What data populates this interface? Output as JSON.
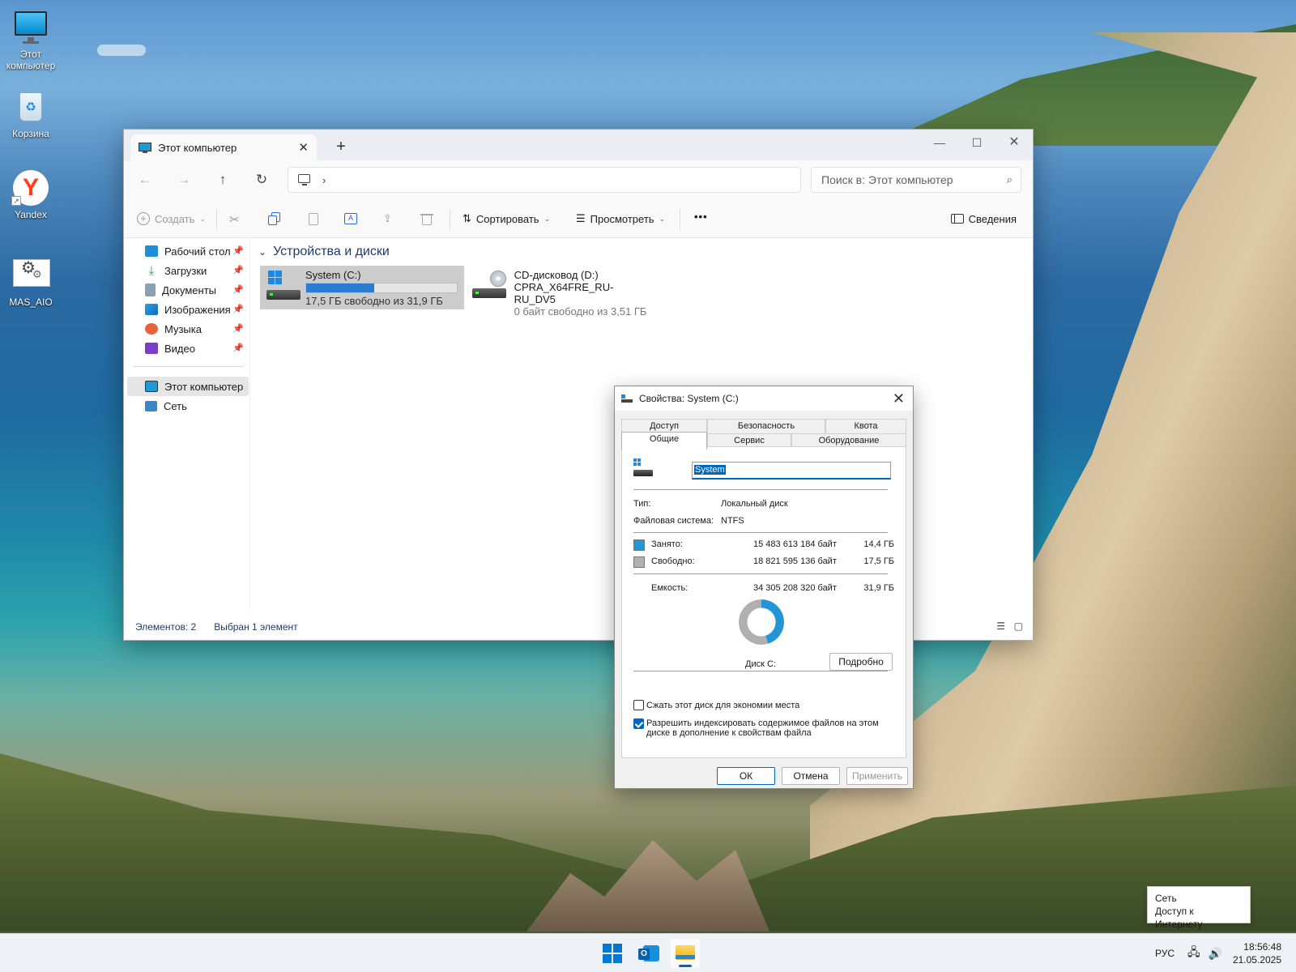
{
  "desktop": {
    "icons": [
      {
        "label_lines": [
          "Этот",
          "компьютер"
        ]
      },
      {
        "label_lines": [
          "Корзина"
        ]
      },
      {
        "label_lines": [
          "Yandex"
        ]
      },
      {
        "label_lines": [
          "MAS_AIO"
        ]
      }
    ]
  },
  "explorer": {
    "tab_title": "Этот компьютер",
    "search_placeholder": "Поиск в: Этот компьютер",
    "toolbar": {
      "create": "Создать",
      "sort": "Сортировать",
      "view": "Просмотреть",
      "more": "•••",
      "details": "Сведения"
    },
    "sidebar": {
      "quick": [
        {
          "label": "Рабочий стол",
          "icon": "desktop-icon"
        },
        {
          "label": "Загрузки",
          "icon": "downloads-icon"
        },
        {
          "label": "Документы",
          "icon": "documents-icon"
        },
        {
          "label": "Изображения",
          "icon": "pictures-icon"
        },
        {
          "label": "Музыка",
          "icon": "music-icon"
        },
        {
          "label": "Видео",
          "icon": "videos-icon"
        }
      ],
      "this_pc": "Этот компьютер",
      "network": "Сеть"
    },
    "group_title": "Устройства и диски",
    "drives": [
      {
        "name": "System (C:)",
        "free_text": "17,5 ГБ свободно из 31,9 ГБ",
        "used_fraction": 0.45
      },
      {
        "name": "CD-дисковод (D:)",
        "label": "CPRA_X64FRE_RU-RU_DV5",
        "free_text": "0 байт свободно из 3,51 ГБ"
      }
    ],
    "status": {
      "items": "Элементов: 2",
      "selected": "Выбран 1 элемент"
    }
  },
  "dialog": {
    "title": "Свойства: System (C:)",
    "tabs_row1": [
      "Доступ",
      "Безопасность",
      "Квота"
    ],
    "tabs_row2": [
      "Общие",
      "Сервис",
      "Оборудование"
    ],
    "volume_name": "System",
    "type_label": "Тип:",
    "type_value": "Локальный диск",
    "fs_label": "Файловая система:",
    "fs_value": "NTFS",
    "used_label": "Занято:",
    "used_bytes": "15 483 613 184 байт",
    "used_gb": "14,4 ГБ",
    "free_label": "Свободно:",
    "free_bytes": "18 821 595 136 байт",
    "free_gb": "17,5 ГБ",
    "capacity_label": "Емкость:",
    "capacity_bytes": "34 305 208 320 байт",
    "capacity_gb": "31,9 ГБ",
    "used_fraction": 0.451,
    "disk_label": "Диск C:",
    "details_button": "Подробно",
    "compress_label": "Сжать этот диск для экономии места",
    "compress_checked": false,
    "index_label_1": "Разрешить индексировать содержимое файлов на этом",
    "index_label_2": "диске в дополнение к свойствам файла",
    "index_checked": true,
    "ok": "ОК",
    "cancel": "Отмена",
    "apply": "Применить",
    "colors": {
      "used": "#2496d6",
      "free": "#b0b0b0"
    }
  },
  "taskbar": {
    "lang": "РУС",
    "time": "18:56:48",
    "date": "21.05.2025"
  },
  "tooltip": {
    "line1": "Сеть",
    "line2": "Доступ к Интернету"
  }
}
